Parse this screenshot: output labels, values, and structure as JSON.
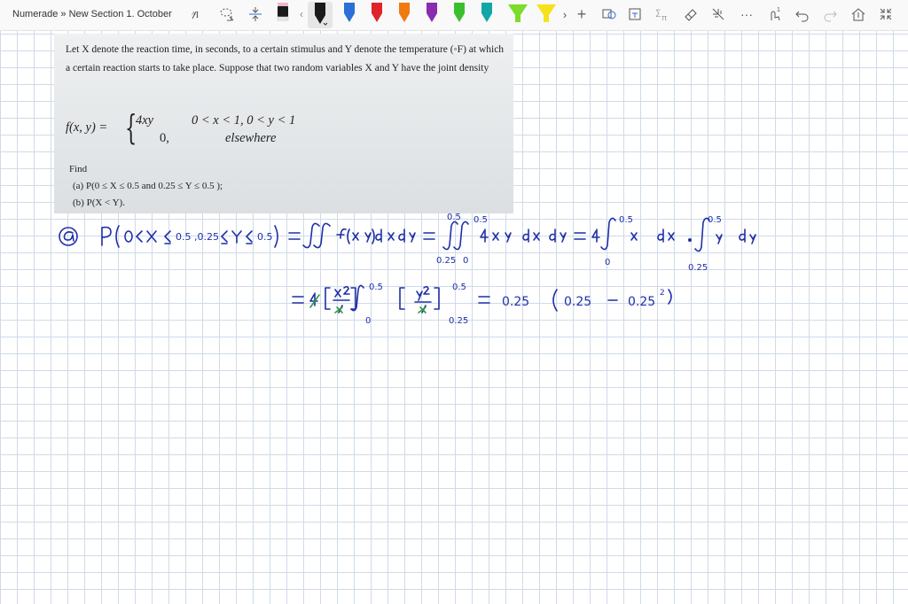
{
  "window": {
    "breadcrumb": "Numerade » New Section 1. October"
  },
  "toolbar": {
    "icons": [
      "text-selection-icon",
      "lasso-select-icon",
      "insert-space-icon",
      "pen-black-icon",
      "pen-black-selected-icon",
      "pen-blue-icon",
      "pen-red-icon",
      "pen-orange-icon",
      "pen-purple-icon",
      "pen-green-icon",
      "pen-teal-icon",
      "highlighter-green-icon",
      "highlighter-yellow-icon",
      "add-pen-icon",
      "shape-convert-icon",
      "ink-to-text-icon",
      "ink-to-math-icon",
      "eraser-icon",
      "ruler-icon",
      "more-icon",
      "touch-writing-icon",
      "undo-icon",
      "redo-icon",
      "share-icon",
      "fullscreen-icon"
    ],
    "colors": {
      "black": "#1a1a1a",
      "blue": "#2c6fd6",
      "red": "#e0242b",
      "orange": "#f07a12",
      "purple": "#8b2bb0",
      "green": "#3cbf2e",
      "teal": "#12a6a6",
      "highlighter_green": "#7bdc2a",
      "highlighter_yellow": "#f6e21b"
    },
    "pens": {
      "more_label": "›",
      "add_label": "+"
    },
    "more_label": "···"
  },
  "problem": {
    "text": "Let X denote the reaction time, in seconds, to a certain stimulus and Y denote the temperature (◦F) at which a certain reaction starts to take place. Suppose that two random variables X and Y have the joint density",
    "formula_lhs": "f(x, y) =",
    "formula_case1_expr": "4xy",
    "formula_case1_cond": "0 < x < 1,  0 < y < 1",
    "formula_case2_expr": "0,",
    "formula_case2_cond": "elsewhere",
    "find_label": "Find",
    "part_a": "(a) P(0 ≤ X ≤ 0.5 and 0.25 ≤ Y ≤ 0.5 );",
    "part_b": "(b) P(X < Y)."
  },
  "handwriting": {
    "line1": "(a)  P( 0 ≤ X ≤ 0.5 , 0.25 ≤ Y ≤ 0.5 ) = ∬ f(x,y) dx dy = ∫∫ 4xy dx dy = 4 ∫ x dx · ∫ y dy",
    "line2": "= 4 [ x²/2 ] [ y²/2 ] = 0.25 ( 0.25 − 0.25² )",
    "ink_color": "#1f2fa8",
    "strike_color": "#2e9b3a"
  }
}
